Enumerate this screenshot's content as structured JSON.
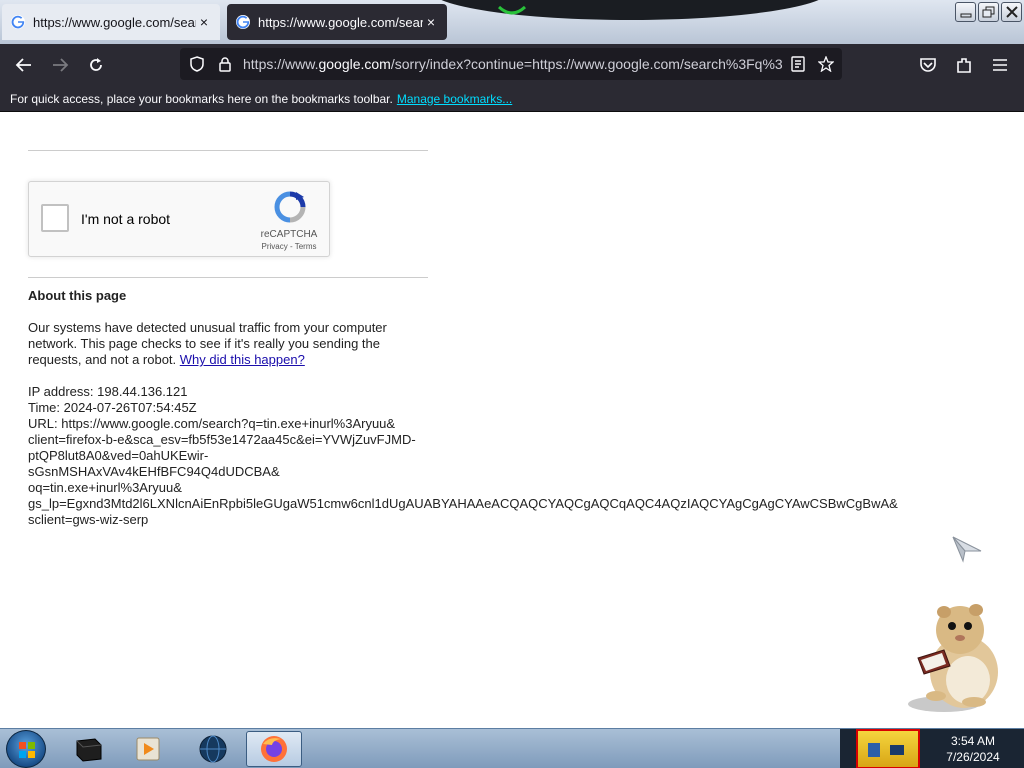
{
  "browser": {
    "tabs": [
      {
        "title": "https://www.google.com/search?q=",
        "active": false,
        "close": "×"
      },
      {
        "title": "https://www.google.com/search?q=",
        "active": true,
        "close": "×"
      }
    ],
    "url": {
      "prefix": "https://www.",
      "domain": "google.com",
      "rest": "/sorry/index?continue=https://www.google.com/search%3Fq%3"
    },
    "bookmarks_bar": {
      "message": "For quick access, place your bookmarks here on the bookmarks toolbar.",
      "link": "Manage bookmarks..."
    },
    "accent_color": "#00ddff"
  },
  "captcha": {
    "label": "I'm not a robot",
    "brand": "reCAPTCHA",
    "links": "Privacy - Terms",
    "checked": false
  },
  "about": {
    "title": "About this page",
    "text": "Our systems have detected unusual traffic from your computer network. This page checks to see if it's really you sending the requests, and not a robot.",
    "link": "Why did this happen?"
  },
  "details": {
    "ip": "IP address: 198.44.136.121",
    "time": "Time: 2024-07-26T07:54:45Z",
    "url_lines": [
      "URL: https://www.google.com/search?q=tin.exe+inurl%3Aryuu&",
      "client=firefox-b-e&sca_esv=fb5f53e1472aa45c&ei=YVWjZuvFJMD-",
      "ptQP8lut8A0&ved=0ahUKEwir-",
      "sGsnMSHAxVAv4kEHfBFC94Q4dUDCBA&",
      "oq=tin.exe+inurl%3Aryuu&",
      "gs_lp=Egxnd3Mtd2l6LXNlcnAiEnRpbi5leGUgaW51cmw6cnl1dUgAUABYAHAAeACQAQCYAQCgAQCqAQC4AQzIAQCYAgCgAgCYAwCSBwCgBwA&",
      "sclient=gws-wiz-serp"
    ]
  },
  "taskbar": {
    "time": "3:54 AM",
    "date": "7/26/2024",
    "items": [
      "terminal-icon",
      "media-player-icon",
      "globe-icon",
      "firefox-icon"
    ]
  }
}
